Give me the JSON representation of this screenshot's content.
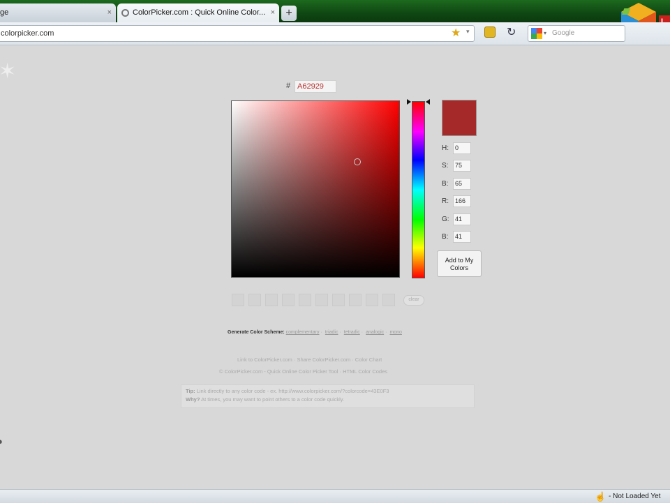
{
  "browser": {
    "tabs": [
      {
        "title": "ge",
        "close": "×"
      },
      {
        "title": "ColorPicker.com : Quick Online Color...",
        "close": "×"
      }
    ],
    "new_tab_label": "+",
    "url": "colorpicker.com",
    "search_placeholder": "Google",
    "logo_corner_text": "L"
  },
  "picker": {
    "hash_label": "#",
    "hex_value": "A62929",
    "swatch_color": "#A62929",
    "fields": [
      {
        "label": "H:",
        "value": "0"
      },
      {
        "label": "S:",
        "value": "75"
      },
      {
        "label": "B:",
        "value": "65"
      },
      {
        "label": "R:",
        "value": "166"
      },
      {
        "label": "G:",
        "value": "41"
      },
      {
        "label": "B:",
        "value": "41"
      }
    ],
    "add_button": "Add to My Colors",
    "clear_label": "clear"
  },
  "schemes": {
    "heading": "Generate Color Scheme:",
    "links": [
      "complementary",
      "triadic",
      "tetradic",
      "analogic",
      "mono"
    ]
  },
  "footer": {
    "links_line": "Link to ColorPicker.com · Share ColorPicker.com · Color Chart",
    "copyright_line": "© ColorPicker.com - Quick Online Color Picker Tool · HTML Color Codes",
    "tip_label": "Tip:",
    "tip_text": "Link directly to any color code - ex. http://www.colorpicker.com/?colorcode=43E0F3",
    "why_label": "Why?",
    "why_text": "At times, you may want to point others to a color code quickly."
  },
  "status": {
    "text": "- Not Loaded Yet"
  }
}
